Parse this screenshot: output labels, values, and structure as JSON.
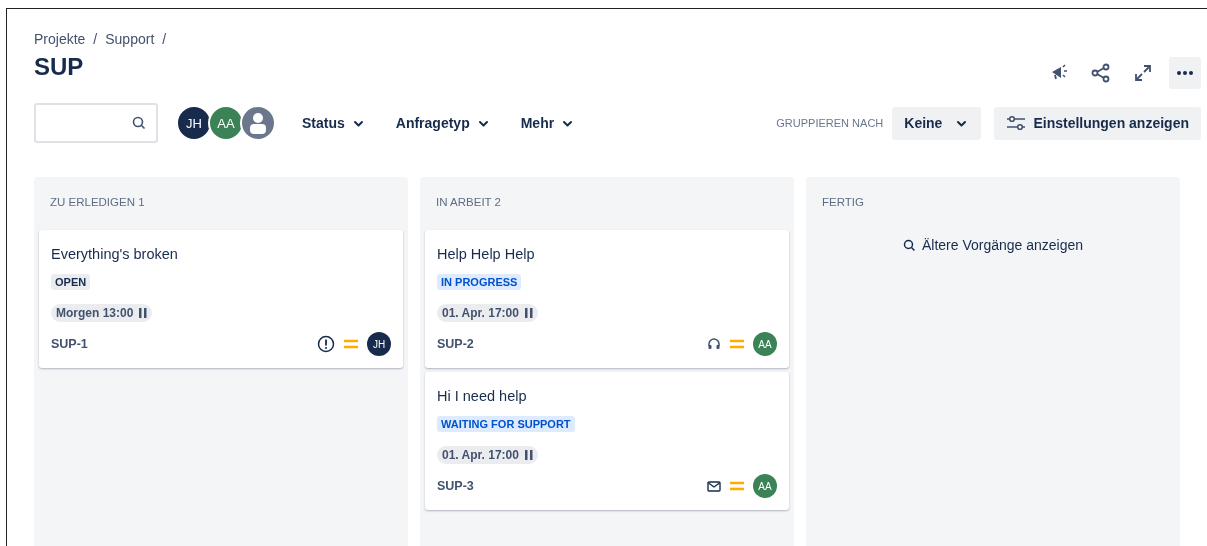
{
  "breadcrumbs": [
    {
      "label": "Projekte",
      "separator": "/"
    },
    {
      "label": "Support",
      "separator": "/"
    }
  ],
  "title": "SUP",
  "header_actions": [
    {
      "kind": "megaphone"
    },
    {
      "kind": "share"
    },
    {
      "kind": "expand"
    },
    {
      "kind": "more"
    }
  ],
  "avatars": [
    {
      "kind": "initials",
      "initials": "JH",
      "color": "#172b4d"
    },
    {
      "kind": "initials",
      "initials": "AA",
      "color": "#3b8356"
    },
    {
      "kind": "silhouette",
      "color": "#6b778c"
    }
  ],
  "filters": [
    "Status",
    "Anfragetyp",
    "Mehr"
  ],
  "group_by": {
    "label": "GRUPPIEREN NACH",
    "value": "Keine"
  },
  "settings_button": "Einstellungen anzeigen",
  "columns": [
    {
      "title": "ZU ERLEDIGEN 1",
      "issues": [
        {
          "summary": "Everything's broken",
          "status": {
            "label": "OPEN",
            "kind": "neutral"
          },
          "due": "Morgen 13:00",
          "key": "SUP-1",
          "icons": [
            {
              "kind": "incident"
            },
            {
              "kind": "priority_medium"
            }
          ],
          "assignee": {
            "initials": "JH",
            "color": "#172b4d"
          }
        }
      ]
    },
    {
      "title": "IN ARBEIT 2",
      "issues": [
        {
          "summary": "Help Help Help",
          "status": {
            "label": "IN PROGRESS",
            "kind": "inprogress"
          },
          "due": "01. Apr. 17:00",
          "key": "SUP-2",
          "icons": [
            {
              "kind": "support"
            },
            {
              "kind": "priority_medium"
            }
          ],
          "assignee": {
            "initials": "AA",
            "color": "#3b8356"
          }
        },
        {
          "summary": "Hi I need help",
          "status": {
            "label": "WAITING FOR SUPPORT",
            "kind": "inprogress"
          },
          "due": "01. Apr. 17:00",
          "key": "SUP-3",
          "icons": [
            {
              "kind": "email"
            },
            {
              "kind": "priority_medium"
            }
          ],
          "assignee": {
            "initials": "AA",
            "color": "#3b8356"
          }
        }
      ]
    },
    {
      "title": "FERTIG",
      "link": "Ältere Vorgänge anzeigen"
    }
  ]
}
